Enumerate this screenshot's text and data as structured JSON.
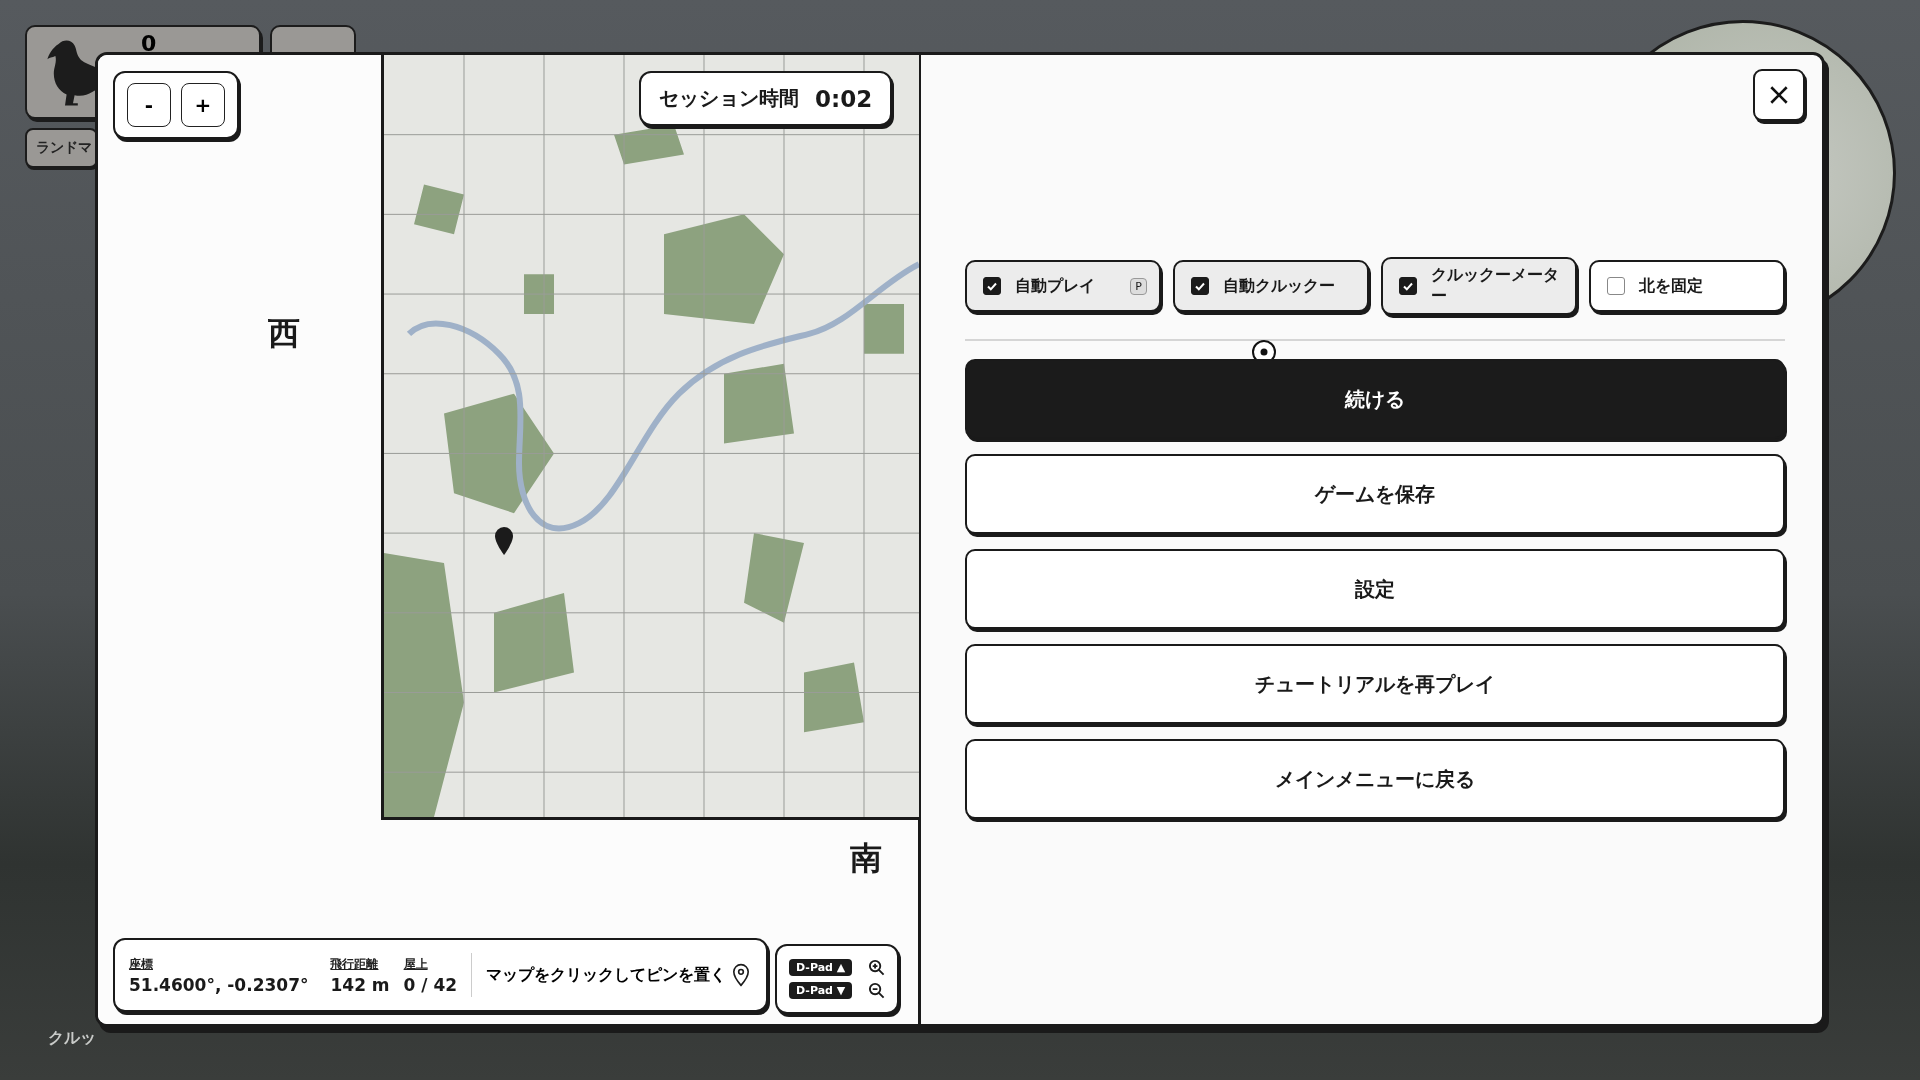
{
  "hud": {
    "pigeon_count": "0",
    "landmark_button": "ランドマ",
    "ground_label": "クルッ"
  },
  "map_panel": {
    "zoom_buttons": [
      "-",
      "+"
    ],
    "session": {
      "label": "セッション時間",
      "time": "0:02"
    },
    "compass": [
      {
        "label": "西",
        "kind": "west"
      },
      {
        "label": "南",
        "kind": "south"
      }
    ],
    "info_bar": {
      "fields": [
        {
          "label": "座標",
          "value": "51.4600°, -0.2307°"
        },
        {
          "label": "飛行距離",
          "value": "142 m"
        },
        {
          "label": "屋上",
          "value": "0 / 42"
        }
      ],
      "hint": "マップをクリックしてピンを置く",
      "dpad": [
        {
          "label": "D-Pad ▲",
          "kind": "zoom-in"
        },
        {
          "label": "D-Pad ▼",
          "kind": "zoom-out"
        }
      ]
    }
  },
  "menu": {
    "toggles": [
      {
        "label": "自動プレイ",
        "checked": true,
        "key": "P"
      },
      {
        "label": "自動クルックー",
        "checked": true
      },
      {
        "label": "クルックーメーター",
        "checked": true
      },
      {
        "label": "北を固定",
        "checked": false
      }
    ],
    "buttons": [
      {
        "label": "続ける",
        "kind": "primary"
      },
      {
        "label": "ゲームを保存",
        "kind": "secondary"
      },
      {
        "label": "設定",
        "kind": "secondary"
      },
      {
        "label": "チュートリアルを再プレイ",
        "kind": "secondary"
      },
      {
        "label": "メインメニューに戻る",
        "kind": "secondary"
      }
    ]
  }
}
